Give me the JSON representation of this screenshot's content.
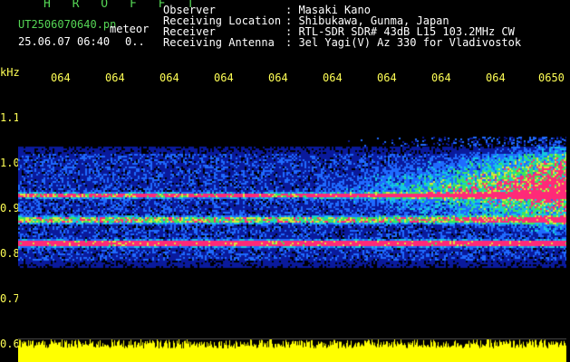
{
  "header": {
    "brand": "H R O F F T",
    "filename": "UT2506070640.pn",
    "meteor_label": "meteor",
    "datetime": "25.06.07 06:40",
    "count": "0.."
  },
  "meta": [
    {
      "label": "Observer",
      "value": ": Masaki Kano"
    },
    {
      "label": "Receiving Location",
      "value": ": Shibukawa, Gunma, Japan"
    },
    {
      "label": "Receiver",
      "value": ": RTL-SDR SDR# 43dB L15 103.2MHz CW"
    },
    {
      "label": "Receiving Antenna",
      "value": ": 3el Yagi(V) Az 330 for Vladivostok"
    }
  ],
  "axis": {
    "y_unit": "kHz",
    "y_ticks": [
      "1.1",
      "1.0",
      "0.9",
      "0.8",
      "0.7",
      "0.6"
    ],
    "x_ticks": [
      "064",
      "064",
      "064",
      "064",
      "064",
      "064",
      "064",
      "064",
      "064",
      "0650"
    ]
  },
  "colors": {
    "background": "#000000",
    "header_green": "#55d655",
    "axis_yellow": "#ffff55",
    "waveform_yellow": "#ffff00"
  }
}
